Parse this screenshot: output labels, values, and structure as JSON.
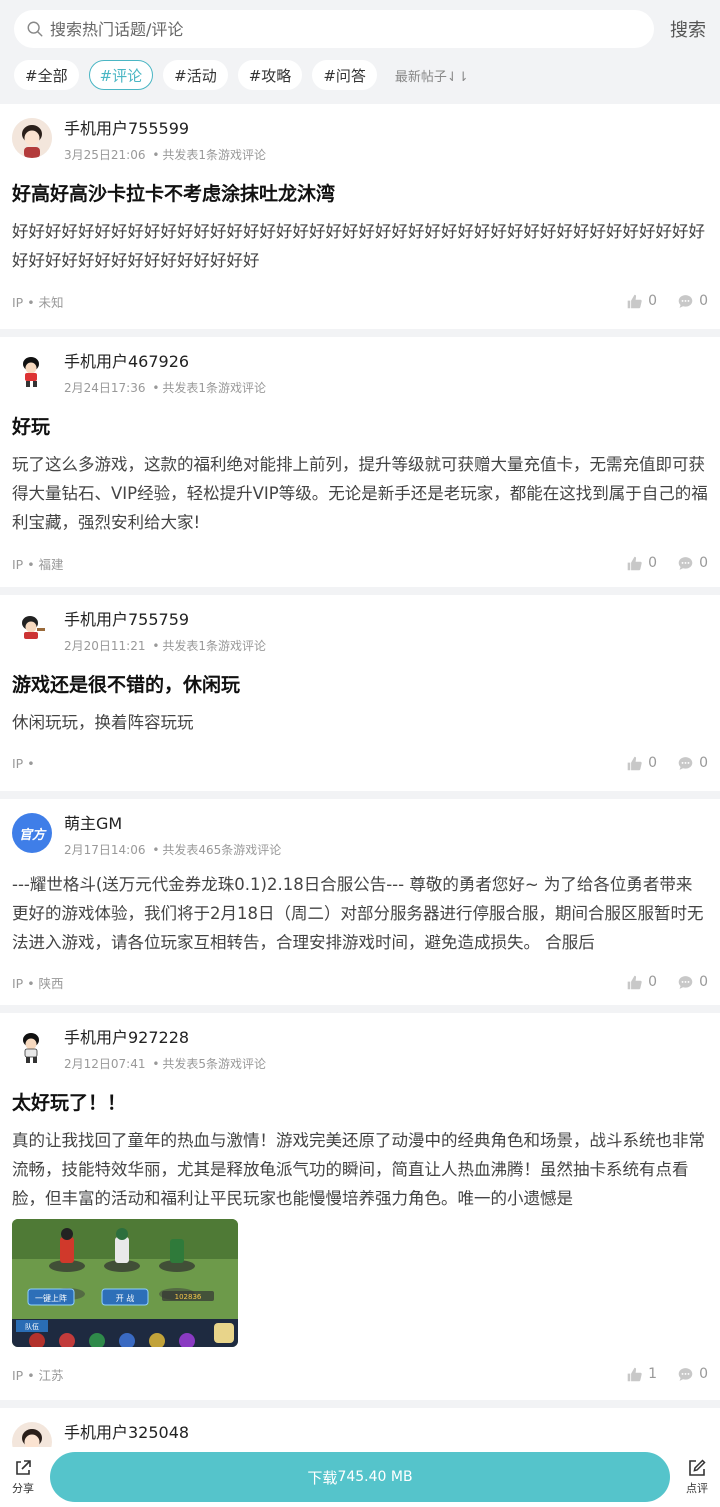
{
  "search": {
    "placeholder": "搜索热门话题/评论",
    "button_label": "搜索"
  },
  "tags": [
    {
      "label": "#全部"
    },
    {
      "label": "#评论"
    },
    {
      "label": "#活动"
    },
    {
      "label": "#攻略"
    },
    {
      "label": "#问答"
    }
  ],
  "sort_label": "最新帖子⇃⇂",
  "posts": [
    {
      "user": "手机用户755599",
      "date": "3月25日21:06",
      "dot": "•",
      "count_text": "共发表1条游戏评论",
      "title": "好高好高沙卡拉卡不考虑涂抹吐龙沐湾",
      "body": "好好好好好好好好好好好好好好好好好好好好好好好好好好好好好好好好好好好好好好好好好好好好好好好好好好好好好好好好好",
      "ip": "IP • 未知",
      "likes": "0",
      "comments": "0"
    },
    {
      "user": "手机用户467926",
      "date": "2月24日17:36",
      "dot": "•",
      "count_text": "共发表1条游戏评论",
      "title": "好玩",
      "body": "玩了这么多游戏，这款的福利绝对能排上前列，提升等级就可获赠大量充值卡，无需充值即可获得大量钻石、VIP经验，轻松提升VIP等级。无论是新手还是老玩家，都能在这找到属于自己的福利宝藏，强烈安利给大家!",
      "ip": "IP • 福建",
      "likes": "0",
      "comments": "0"
    },
    {
      "user": "手机用户755759",
      "date": "2月20日11:21",
      "dot": "•",
      "count_text": "共发表1条游戏评论",
      "title": "游戏还是很不错的，休闲玩",
      "body": "休闲玩玩，换着阵容玩玩",
      "ip": "IP •",
      "likes": "0",
      "comments": "0"
    },
    {
      "user": "萌主GM",
      "avatar_label": "官方",
      "date": "2月17日14:06",
      "dot": "•",
      "count_text": "共发表465条游戏评论",
      "body": "---耀世格斗(送万元代金券龙珠0.1)2.18日合服公告--- 尊敬的勇者您好~ 为了给各位勇者带来更好的游戏体验，我们将于2月18日（周二）对部分服务器进行停服合服，期间合服区服暂时无法进入游戏，请各位玩家互相转告，合理安排游戏时间，避免造成损失。 合服后",
      "ip": "IP • 陕西",
      "likes": "0",
      "comments": "0"
    },
    {
      "user": "手机用户927228",
      "date": "2月12日07:41",
      "dot": "•",
      "count_text": "共发表5条游戏评论",
      "title": "太好玩了！！",
      "body": "真的让我找回了童年的热血与激情！游戏完美还原了动漫中的经典角色和场景，战斗系统也非常流畅，技能特效华丽，尤其是释放龟派气功的瞬间，简直让人热血沸腾！虽然抽卡系统有点看脸，但丰富的活动和福利让平民玩家也能慢慢培养强力角色。唯一的小遗憾是",
      "shot": {
        "btn1": "一键上阵",
        "btn2": "开 战",
        "tab": "队伍",
        "power": "102836"
      },
      "ip": "IP • 江苏",
      "likes": "1",
      "comments": "0"
    },
    {
      "user": "手机用户325048"
    }
  ],
  "bottom": {
    "share_label": "分享",
    "download_label": "下载",
    "download_size": "745.40 MB",
    "review_label": "点评"
  },
  "colors": {
    "accent": "#4ab6c4",
    "download": "#55c4cb",
    "official": "#3f7ee8"
  }
}
